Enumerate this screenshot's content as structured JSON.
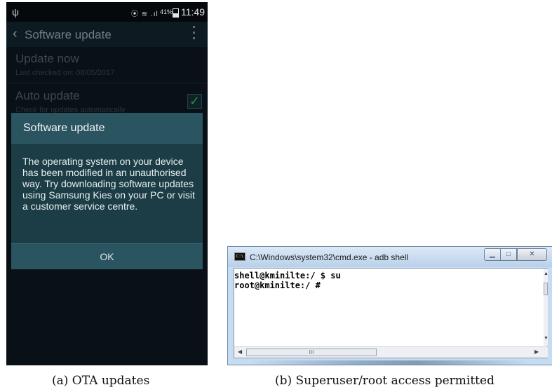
{
  "phone": {
    "status_bar": {
      "battery": "41%",
      "time": "11:49"
    },
    "app_title": "Software update",
    "settings": {
      "update_now": {
        "title": "Update now",
        "subtitle": "Last checked on: 08/05/2017"
      },
      "auto_update": {
        "title": "Auto update",
        "subtitle": "Check for updates automatically",
        "checked": true
      }
    },
    "dialog": {
      "title": "Software update",
      "message": "The operating system on your device has been modified in an unauthorised way. Try downloading software updates using Samsung Kies on your PC or visit a customer service centre.",
      "ok_label": "OK"
    },
    "colors": {
      "background": "#0a1116",
      "dialog": "#1d3d46",
      "dialog_header": "#2a5560",
      "checkbox_check": "#2f8a3f"
    }
  },
  "cmd": {
    "title": "C:\\Windows\\system32\\cmd.exe - adb  shell",
    "icon_label": "C:\\",
    "lines": [
      "shell@kminilte:/ $ su",
      "root@kminilte:/ #"
    ],
    "scroll_grip": "III"
  },
  "captions": {
    "a": "(a) OTA updates",
    "b": "(b) Superuser/root access permitted"
  }
}
